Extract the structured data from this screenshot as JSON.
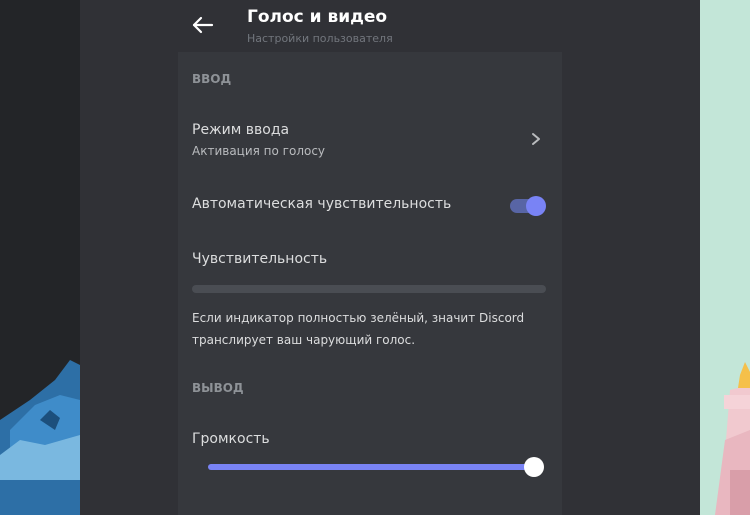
{
  "header": {
    "title": "Голос и видео",
    "subtitle": "Настройки пользователя",
    "back_icon": "arrow-left-icon"
  },
  "input_section": {
    "label": "ВВОД",
    "input_mode": {
      "title": "Режим ввода",
      "value": "Активация по голосу",
      "icon": "chevron-right-icon"
    },
    "auto_sensitivity": {
      "label": "Автоматическая чувствительность",
      "enabled": true
    },
    "sensitivity": {
      "label": "Чувствительность",
      "description": "Если индикатор полностью зелёный, значит Discord транслирует ваш чарующий голос."
    }
  },
  "output_section": {
    "label": "ВЫВОД",
    "volume": {
      "label": "Громкость",
      "level": 1.0
    }
  },
  "colors": {
    "accent": "#7983f5",
    "background": "#36383d",
    "text": "#dcddde",
    "muted": "#8e9297"
  }
}
